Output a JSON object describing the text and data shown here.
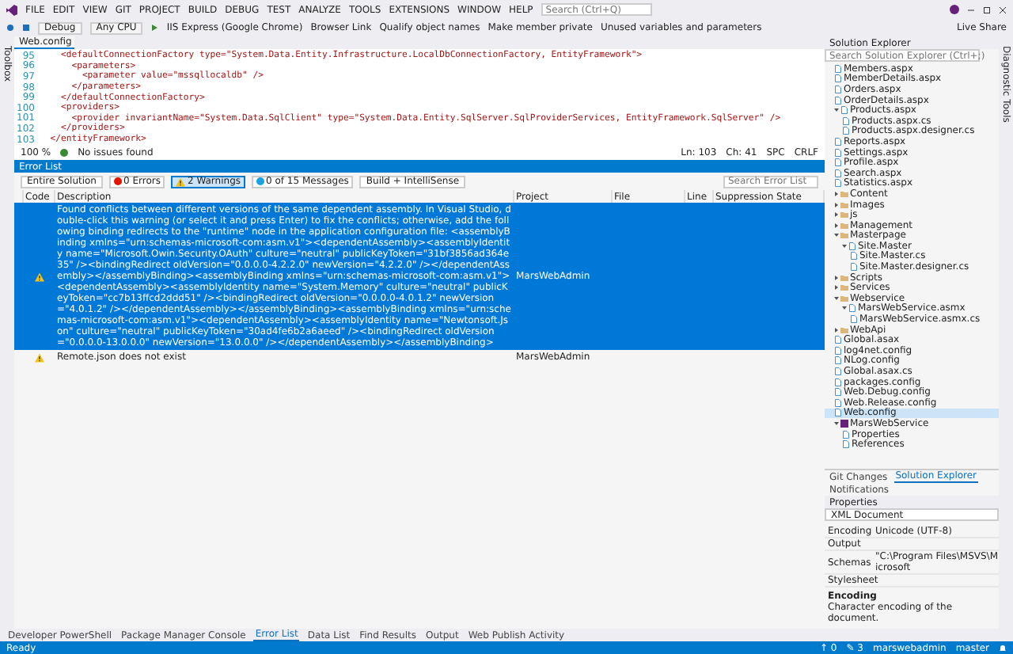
{
  "menu_bar": {
    "items": [
      "FILE",
      "EDIT",
      "VIEW",
      "GIT",
      "PROJECT",
      "BUILD",
      "DEBUG",
      "TEST",
      "ANALYZE",
      "TOOLS",
      "EXTENSIONS",
      "WINDOW",
      "HELP"
    ],
    "search_placeholder": "Search (Ctrl+Q)"
  },
  "toolbar": {
    "configuration": "Debug",
    "platform": "Any CPU",
    "run_target": "IIS Express (Google Chrome)",
    "commands": [
      "Browser Link",
      "Qualify object names",
      "Make member private",
      "Unused variables and parameters"
    ],
    "live_share": "Live Share"
  },
  "left_strip": "Toolbox",
  "right_strip": "Diagnostic Tools",
  "editor": {
    "tab": "Web.config",
    "lines": [
      {
        "number": "95",
        "text": "    <defaultConnectionFactory type=\"System.Data.Entity.Infrastructure.LocalDbConnectionFactory, EntityFramework\">"
      },
      {
        "number": "96",
        "text": "      <parameters>"
      },
      {
        "number": "97",
        "text": "        <parameter value=\"mssqllocaldb\" />"
      },
      {
        "number": "98",
        "text": "      </parameters>"
      },
      {
        "number": "99",
        "text": "    </defaultConnectionFactory>"
      },
      {
        "number": "100",
        "text": "    <providers>"
      },
      {
        "number": "101",
        "text": "      <provider invariantName=\"System.Data.SqlClient\" type=\"System.Data.Entity.SqlServer.SqlProviderServices, EntityFramework.SqlServer\" />"
      },
      {
        "number": "102",
        "text": "    </providers>"
      },
      {
        "number": "103",
        "text": "  </entityFramework>"
      }
    ],
    "zoom": "100 %",
    "issues": "No issues found",
    "position": [
      "Ln: 103",
      "Ch: 41",
      "SPC",
      "CRLF"
    ]
  },
  "error_list": {
    "title": "Error List",
    "scope": "Entire Solution",
    "filters": [
      {
        "kind": "error",
        "label": "0 Errors",
        "selected": false
      },
      {
        "kind": "warning",
        "label": "2 Warnings",
        "selected": true
      },
      {
        "kind": "message",
        "label": "0 of 15 Messages",
        "selected": false
      }
    ],
    "build_filter": "Build + IntelliSense",
    "search_placeholder": "Search Error List",
    "columns": [
      "Code",
      "Description",
      "Project",
      "File",
      "Line",
      "Suppression State"
    ],
    "rows": [
      {
        "kind": "warning",
        "selected": true,
        "project": "MarsWebAdmin",
        "description": "Found conflicts between different versions of the same dependent assembly. In Visual Studio, double-click this warning (or select it and press Enter) to fix the conflicts; otherwise, add the following binding redirects to the \"runtime\" node in the application configuration file: <assemblyBinding xmlns=\"urn:schemas-microsoft-com:asm.v1\"><dependentAssembly><assemblyIdentity name=\"Microsoft.Owin.Security.OAuth\" culture=\"neutral\" publicKeyToken=\"31bf3856ad364e35\" /><bindingRedirect oldVersion=\"0.0.0.0-4.2.2.0\" newVersion=\"4.2.2.0\" /></dependentAssembly></assemblyBinding><assemblyBinding xmlns=\"urn:schemas-microsoft-com:asm.v1\"><dependentAssembly><assemblyIdentity name=\"System.Memory\" culture=\"neutral\" publicKeyToken=\"cc7b13ffcd2ddd51\" /><bindingRedirect oldVersion=\"0.0.0.0-4.0.1.2\" newVersion=\"4.0.1.2\" /></dependentAssembly></assemblyBinding><assemblyBinding xmlns=\"urn:schemas-microsoft-com:asm.v1\"><dependentAssembly><assemblyIdentity name=\"Newtonsoft.Json\" culture=\"neutral\" publicKeyToken=\"30ad4fe6b2a6aeed\" /><bindingRedirect oldVersion=\"0.0.0.0-13.0.0.0\" newVersion=\"13.0.0.0\" /></dependentAssembly></assemblyBinding>"
      },
      {
        "kind": "warning",
        "selected": false,
        "project": "MarsWebAdmin",
        "description": "Remote.json does not exist"
      }
    ]
  },
  "solution_explorer": {
    "title": "Solution Explorer",
    "search_placeholder": "Search Solution Explorer (Ctrl+;)",
    "items": [
      {
        "label": "Members.aspx",
        "kind": "file"
      },
      {
        "label": "MemberDetails.aspx",
        "kind": "file"
      },
      {
        "label": "Orders.aspx",
        "kind": "file"
      },
      {
        "label": "OrderDetails.aspx",
        "kind": "file"
      },
      {
        "label": "Products.aspx",
        "kind": "file",
        "expanded": true,
        "children": [
          {
            "label": "Products.aspx.cs",
            "kind": "file"
          },
          {
            "label": "Products.aspx.designer.cs",
            "kind": "file"
          }
        ]
      },
      {
        "label": "Reports.aspx",
        "kind": "file"
      },
      {
        "label": "Settings.aspx",
        "kind": "file"
      },
      {
        "label": "Profile.aspx",
        "kind": "file"
      },
      {
        "label": "Search.aspx",
        "kind": "file"
      },
      {
        "label": "Statistics.aspx",
        "kind": "file"
      },
      {
        "label": "Content",
        "kind": "folder",
        "expanded": false
      },
      {
        "label": "Images",
        "kind": "folder",
        "expanded": false
      },
      {
        "label": "js",
        "kind": "folder",
        "expanded": false
      },
      {
        "label": "Management",
        "kind": "folder",
        "expanded": false
      },
      {
        "label": "Masterpage",
        "kind": "folder",
        "expanded": true,
        "children": [
          {
            "label": "Site.Master",
            "kind": "file",
            "expanded": true,
            "children": [
              {
                "label": "Site.Master.cs",
                "kind": "file"
              },
              {
                "label": "Site.Master.designer.cs",
                "kind": "file"
              }
            ]
          }
        ]
      },
      {
        "label": "Scripts",
        "kind": "folder",
        "expanded": false
      },
      {
        "label": "Services",
        "kind": "folder",
        "expanded": false
      },
      {
        "label": "Webservice",
        "kind": "folder",
        "expanded": true,
        "children": [
          {
            "label": "MarsWebService.asmx",
            "kind": "file",
            "expanded": true,
            "children": [
              {
                "label": "MarsWebService.asmx.cs",
                "kind": "file"
              }
            ]
          }
        ]
      },
      {
        "label": "WebApi",
        "kind": "folder",
        "expanded": false
      },
      {
        "label": "Global.asax",
        "kind": "file"
      },
      {
        "label": "log4net.config",
        "kind": "file"
      },
      {
        "label": "NLog.config",
        "kind": "file"
      },
      {
        "label": "Global.asax.cs",
        "kind": "file"
      },
      {
        "label": "packages.config",
        "kind": "file"
      },
      {
        "label": "Web.Debug.config",
        "kind": "file"
      },
      {
        "label": "Web.Release.config",
        "kind": "file"
      },
      {
        "label": "Web.config",
        "kind": "file",
        "selected": true
      },
      {
        "label": "MarsWebService",
        "kind": "project",
        "expanded": true,
        "children": [
          {
            "label": "Properties",
            "kind": "file"
          },
          {
            "label": "References",
            "kind": "file"
          }
        ]
      }
    ],
    "tabs": [
      {
        "label": "Git Changes",
        "selected": false
      },
      {
        "label": "Solution Explorer",
        "selected": true
      },
      {
        "label": "Notifications",
        "selected": false
      }
    ]
  },
  "properties": {
    "title": "Properties",
    "object": "XML Document",
    "rows": [
      {
        "name": "Encoding",
        "value": "Unicode (UTF-8)"
      },
      {
        "name": "Output"
      },
      {
        "name": "Schemas",
        "value": "\"C:\\Program Files\\MSVS\\Microsoft"
      },
      {
        "name": "Stylesheet"
      }
    ],
    "description_title": "Encoding",
    "description": "Character encoding of the document."
  },
  "bottom_tabs": [
    {
      "label": "Developer PowerShell",
      "selected": false
    },
    {
      "label": "Package Manager Console",
      "selected": false
    },
    {
      "label": "Error List",
      "selected": true
    },
    {
      "label": "Data List",
      "selected": false
    },
    {
      "label": "Find Results",
      "selected": false
    },
    {
      "label": "Output",
      "selected": false
    },
    {
      "label": "Web Publish Activity",
      "selected": false
    }
  ],
  "status_bar": {
    "state": "Ready",
    "items": [
      "↑ 0",
      "✎ 3",
      "marswebadmin",
      "master"
    ]
  }
}
